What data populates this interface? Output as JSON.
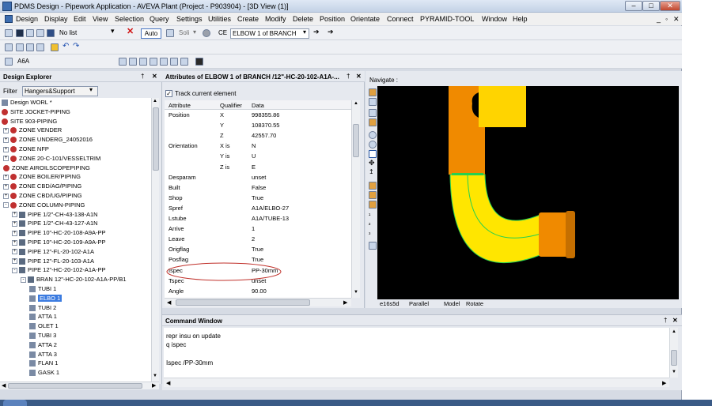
{
  "window": {
    "title": "PDMS Design - Pipework Application - AVEVA Plant (Project - P903904) - [3D View (1)]"
  },
  "menu": [
    "Design",
    "Display",
    "Edit",
    "View",
    "Selection",
    "Query",
    "Settings",
    "Utilities",
    "Create",
    "Modify",
    "Delete",
    "Position",
    "Orientate",
    "Connect",
    "PYRAMID-TOOL",
    "Window",
    "Help"
  ],
  "toolbar1": {
    "list_combo": "No list",
    "auto_button": "Auto",
    "soli_label": "Soli",
    "ce_label": "CE",
    "ce_value": "ELBOW 1 of BRANCH"
  },
  "toolbar3": {
    "element_input": "A6A"
  },
  "design_explorer": {
    "title": "Design Explorer",
    "filter_label": "Filter",
    "filter_value": "Hangers&Support",
    "items": [
      {
        "label": "Design WORL *",
        "depth": 0,
        "exp": ""
      },
      {
        "label": "SITE JOCKET-PIPING",
        "depth": 0,
        "exp": ""
      },
      {
        "label": "SITE 903-PIPING",
        "depth": 0,
        "exp": ""
      },
      {
        "label": "ZONE VENDER",
        "depth": 1,
        "exp": "+"
      },
      {
        "label": "ZONE UNDERG_24052016",
        "depth": 1,
        "exp": "+"
      },
      {
        "label": "ZONE NFP",
        "depth": 1,
        "exp": "+"
      },
      {
        "label": "ZONE 20-C-101/VESSELTRIM",
        "depth": 1,
        "exp": "+"
      },
      {
        "label": "ZONE AIROILSCOPEPIPING",
        "depth": 1,
        "exp": ""
      },
      {
        "label": "ZONE BOILER/PIPING",
        "depth": 1,
        "exp": "+"
      },
      {
        "label": "ZONE CBD/AG/PIPING",
        "depth": 1,
        "exp": "+"
      },
      {
        "label": "ZONE CBD/UG/PIPING",
        "depth": 1,
        "exp": "+"
      },
      {
        "label": "ZONE COLUMN-PIPING",
        "depth": 1,
        "exp": "-"
      },
      {
        "label": "PIPE 1/2\"-CH-43-138-A1N",
        "depth": 2,
        "exp": "+"
      },
      {
        "label": "PIPE 1/2\"-CH-43-127-A1N",
        "depth": 2,
        "exp": "+"
      },
      {
        "label": "PIPE 10\"-HC-20-108-A9A-PP",
        "depth": 2,
        "exp": "+"
      },
      {
        "label": "PIPE 10\"-HC-20-109-A9A-PP",
        "depth": 2,
        "exp": "+"
      },
      {
        "label": "PIPE 12\"-FL-20-102-A1A",
        "depth": 2,
        "exp": "+"
      },
      {
        "label": "PIPE 12\"-FL-20-103-A1A",
        "depth": 2,
        "exp": "+"
      },
      {
        "label": "PIPE 12\"-HC-20-102-A1A-PP",
        "depth": 2,
        "exp": "-"
      },
      {
        "label": "BRAN 12\"-HC-20-102-A1A-PP/B1",
        "depth": 3,
        "exp": "-"
      },
      {
        "label": "TUBI 1",
        "depth": 4,
        "exp": ""
      },
      {
        "label": "ELBO 1",
        "depth": 4,
        "exp": "",
        "selected": true
      },
      {
        "label": "TUBI 2",
        "depth": 4,
        "exp": ""
      },
      {
        "label": "ATTA 1",
        "depth": 4,
        "exp": ""
      },
      {
        "label": "OLET 1",
        "depth": 4,
        "exp": ""
      },
      {
        "label": "TUBI 3",
        "depth": 4,
        "exp": ""
      },
      {
        "label": "ATTA 2",
        "depth": 4,
        "exp": ""
      },
      {
        "label": "ATTA 3",
        "depth": 4,
        "exp": ""
      },
      {
        "label": "FLAN 1",
        "depth": 4,
        "exp": ""
      },
      {
        "label": "GASK 1",
        "depth": 4,
        "exp": ""
      }
    ]
  },
  "attributes": {
    "title": "Attributes of ELBOW 1 of BRANCH /12\"-HC-20-102-A1A-...",
    "track_label": "Track current element",
    "headers": [
      "Attribute",
      "Qualifier",
      "Data"
    ],
    "rows": [
      [
        "Position",
        "X",
        "998355.86"
      ],
      [
        "",
        "Y",
        "108370.55"
      ],
      [
        "",
        "Z",
        "42557.70"
      ],
      [
        "Orientation",
        "X is",
        "N"
      ],
      [
        "",
        "Y is",
        "U"
      ],
      [
        "",
        "Z is",
        "E"
      ],
      [
        "Desparam",
        "",
        "unset"
      ],
      [
        "Built",
        "",
        "False"
      ],
      [
        "Shop",
        "",
        "True"
      ],
      [
        "Spref",
        "",
        "A1A/ELBO-27"
      ],
      [
        "Lstube",
        "",
        "A1A/TUBE-13"
      ],
      [
        "Arrive",
        "",
        "1"
      ],
      [
        "Leave",
        "",
        "2"
      ],
      [
        "Origflag",
        "",
        "True"
      ],
      [
        "Posflag",
        "",
        "True"
      ],
      [
        "Ispec",
        "",
        "PP-30mm"
      ],
      [
        "Tspec",
        "",
        "unset"
      ],
      [
        "Angle",
        "",
        "90.00"
      ]
    ]
  },
  "navigate": {
    "title": "Navigate :",
    "status": [
      "e16s5d",
      "Parallel",
      "Model",
      "Rotate"
    ],
    "colors": {
      "pipe": "#f08a00",
      "elbow": "#ffe600",
      "box": "#ffd400",
      "outline": "#26d050"
    }
  },
  "command_window": {
    "title": "Command Window",
    "lines": [
      "repr insu on update",
      "q ispec",
      "",
      "Ispec /PP-30mm"
    ]
  }
}
